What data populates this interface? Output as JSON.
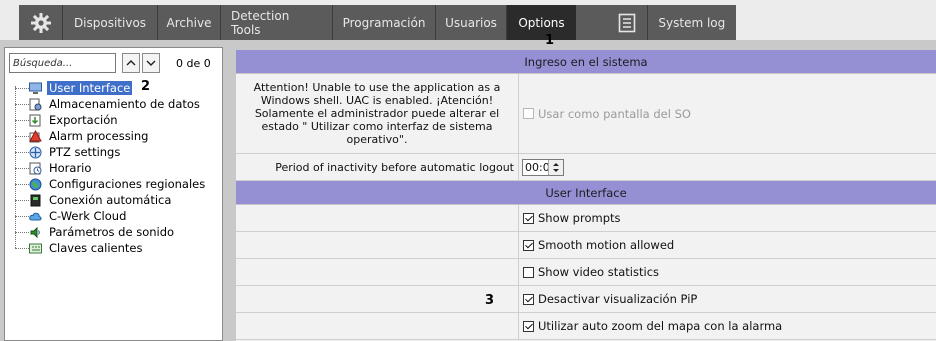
{
  "topbar": {
    "tabs": [
      {
        "label": "Dispositivos"
      },
      {
        "label": "Archive"
      },
      {
        "label": "Detection Tools"
      },
      {
        "label": "Programación"
      },
      {
        "label": "Usuarios"
      },
      {
        "label": "Options",
        "active": true
      }
    ],
    "system_log_label": "System log"
  },
  "markers": {
    "m1": "1",
    "m2": "2",
    "m3": "3"
  },
  "sidebar": {
    "search_placeholder": "Búsqueda...",
    "counter": "0 de 0",
    "items": [
      {
        "label": "User Interface",
        "icon": "monitor-icon",
        "selected": true
      },
      {
        "label": "Almacenamiento de datos",
        "icon": "storage-icon"
      },
      {
        "label": "Exportación",
        "icon": "export-icon"
      },
      {
        "label": "Alarm processing",
        "icon": "alarm-icon"
      },
      {
        "label": "PTZ settings",
        "icon": "ptz-icon"
      },
      {
        "label": "Horario",
        "icon": "schedule-icon"
      },
      {
        "label": "Configuraciones regionales",
        "icon": "globe-icon"
      },
      {
        "label": "Conexión automática",
        "icon": "autologin-icon"
      },
      {
        "label": "C-Werk Cloud",
        "icon": "cloud-icon"
      },
      {
        "label": "Parámetros de sonido",
        "icon": "sound-icon"
      },
      {
        "label": "Claves calientes",
        "icon": "hotkeys-icon"
      }
    ]
  },
  "main": {
    "section1_title": "Ingreso en el sistema",
    "shell_warning": "Attention! Unable to use the application as a Windows shell. UAC is enabled. ¡Atención! Solamente el administrador puede alterar el estado \" Utilizar como interfaz de sistema operativo\".",
    "shell_checkbox_label": "Usar como  pantalla del SO",
    "inactivity_label": "Period of inactivity before automatic logout",
    "inactivity_value": "00:00",
    "section2_title": "User Interface",
    "options": [
      {
        "label": "Show prompts",
        "checked": true
      },
      {
        "label": "Smooth motion allowed",
        "checked": true
      },
      {
        "label": "Show video statistics",
        "checked": false
      },
      {
        "label": "Desactivar visualización PiP",
        "checked": true
      },
      {
        "label": "Utilizar auto zoom del mapa con la alarma",
        "checked": true
      }
    ]
  },
  "colors": {
    "header_bg": "#958fd4",
    "tab_bg": "#5b5b5b",
    "selected": "#3f6fc9"
  }
}
